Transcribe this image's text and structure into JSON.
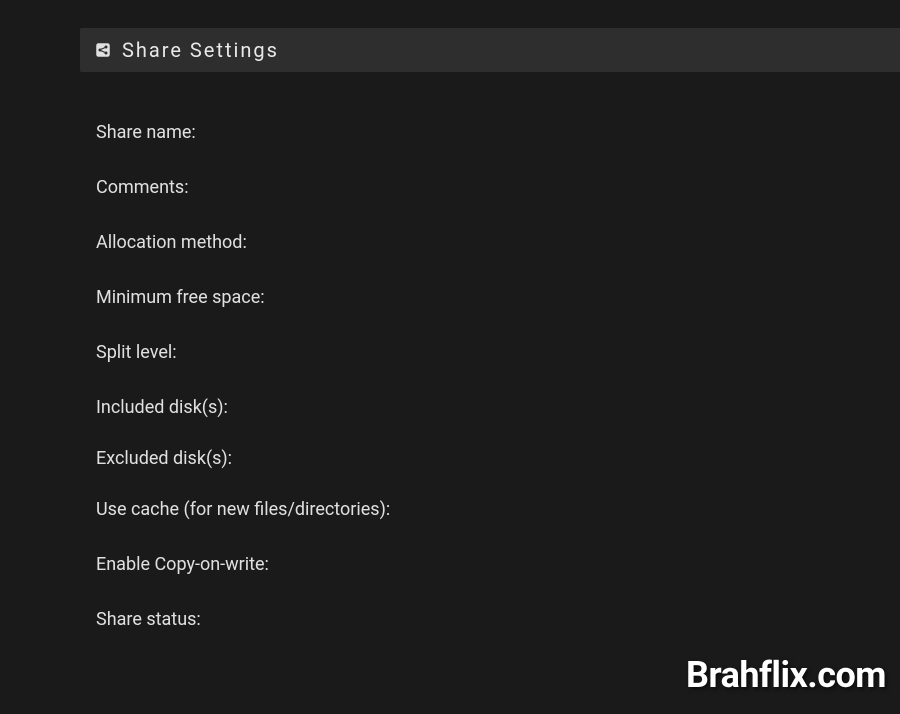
{
  "header": {
    "title": "Share Settings"
  },
  "fields": {
    "share_name": "Share name:",
    "comments": "Comments:",
    "allocation_method": "Allocation method:",
    "minimum_free_space": "Minimum free space:",
    "split_level": "Split level:",
    "included_disks": "Included disk(s):",
    "excluded_disks": "Excluded disk(s):",
    "use_cache": "Use cache (for new files/directories):",
    "enable_cow": "Enable Copy-on-write:",
    "share_status": "Share status:"
  },
  "watermark": "Brahflix.com"
}
